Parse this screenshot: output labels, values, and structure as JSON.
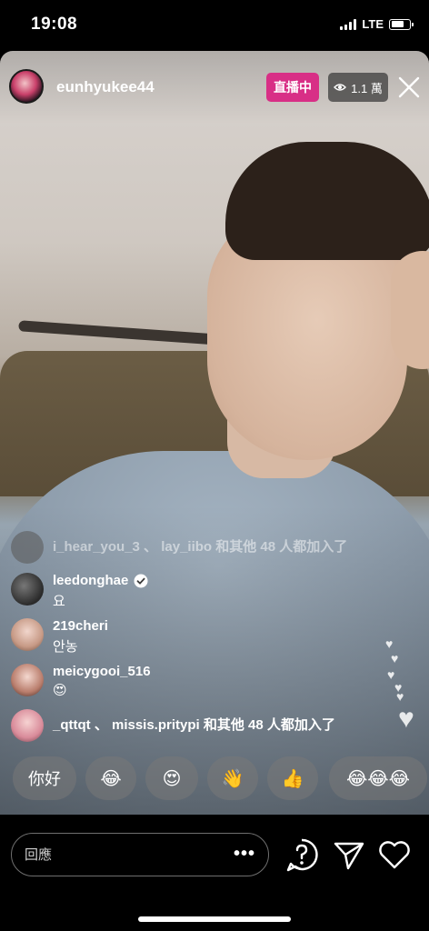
{
  "status_bar": {
    "time": "19:08",
    "network": "LTE",
    "battery_percent": 80
  },
  "header": {
    "username": "eunhyukee44",
    "live_badge": "直播中",
    "viewer_count": "1.1 萬"
  },
  "comments": [
    {
      "type": "join",
      "users": "i_hear_you_3 、 lay_iibo",
      "suffix": "和其他 48 人都加入了"
    },
    {
      "type": "comment",
      "username": "leedonghae",
      "verified": true,
      "message": "요"
    },
    {
      "type": "comment",
      "username": "219cheri",
      "verified": false,
      "message": "안농"
    },
    {
      "type": "comment",
      "username": "meicygooi_516",
      "verified": false,
      "message": "😍"
    },
    {
      "type": "join",
      "users": "_qttqt 、 missis.pritypi",
      "suffix": "和其他 48 人都加入了"
    }
  ],
  "quick_replies": [
    "你好",
    "😂",
    "😍",
    "👋",
    "👍",
    "😂😂😂"
  ],
  "reply_bar": {
    "placeholder": "回應",
    "more": "•••"
  },
  "icons": [
    "eye-icon",
    "close-icon",
    "verified-badge-icon",
    "heart-icon",
    "question-icon",
    "send-icon",
    "like-heart-icon"
  ]
}
